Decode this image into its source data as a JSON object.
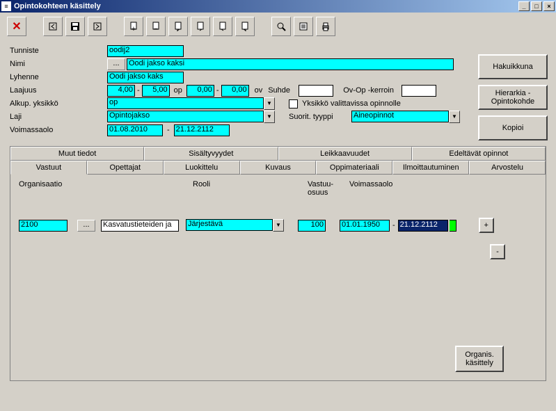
{
  "title": "Opintokohteen käsittely",
  "fields": {
    "tunniste_lbl": "Tunniste",
    "tunniste": "oodij2",
    "nimi_lbl": "Nimi",
    "nimi_btn": "...",
    "nimi": "Oodi jakso kaksi",
    "lyhenne_lbl": "Lyhenne",
    "lyhenne": "Oodi jakso kaks",
    "laajuus_lbl": "Laajuus",
    "laajuus_min": "4,00",
    "laajuus_max": "5,00",
    "laajuus_unit": "op",
    "laajuus_v1": "0,00",
    "laajuus_v2": "0,00",
    "laajuus_unit2": "ov",
    "suhde_lbl": "Suhde",
    "ovop_lbl": "Ov-Op -kerroin",
    "alkup_lbl": "Alkup. yksikkö",
    "alkup": "op",
    "yksikko_chk": "Yksikkö valittavissa opinnolle",
    "laji_lbl": "Laji",
    "laji": "Opintojakso",
    "suorit_lbl": "Suorit. tyyppi",
    "suorit": "Aineopinnot",
    "voimassa_lbl": "Voimassaolo",
    "voimassa_from": "01.08.2010",
    "voimassa_to": "21.12.2112"
  },
  "buttons": {
    "haku": "Hakuikkuna",
    "hier": "Hierarkia - Opintokohde",
    "kopioi": "Kopioi",
    "org": "Organis. käsittely",
    "plus": "+",
    "minus": "-"
  },
  "tabs1": {
    "muut": "Muut tiedot",
    "sis": "Sisältyvyydet",
    "leik": "Leikkaavuudet",
    "edel": "Edeltävät opinnot"
  },
  "tabs2": {
    "vastuut": "Vastuut",
    "opettajat": "Opettajat",
    "luok": "Luokittelu",
    "kuvaus": "Kuvaus",
    "oppi": "Oppimateriaali",
    "ilmo": "Ilmoittautuminen",
    "arv": "Arvostelu"
  },
  "cols": {
    "org": "Organisaatio",
    "rooli": "Rooli",
    "vastuu": "Vastuu-osuus",
    "voima": "Voimassaolo"
  },
  "row": {
    "org_code": "2100",
    "org_btn": "...",
    "org_name": "Kasvatustieteiden ja",
    "rooli": "Järjestävä",
    "osuus": "100",
    "from": "01.01.1950",
    "to": "21.12.2112"
  }
}
